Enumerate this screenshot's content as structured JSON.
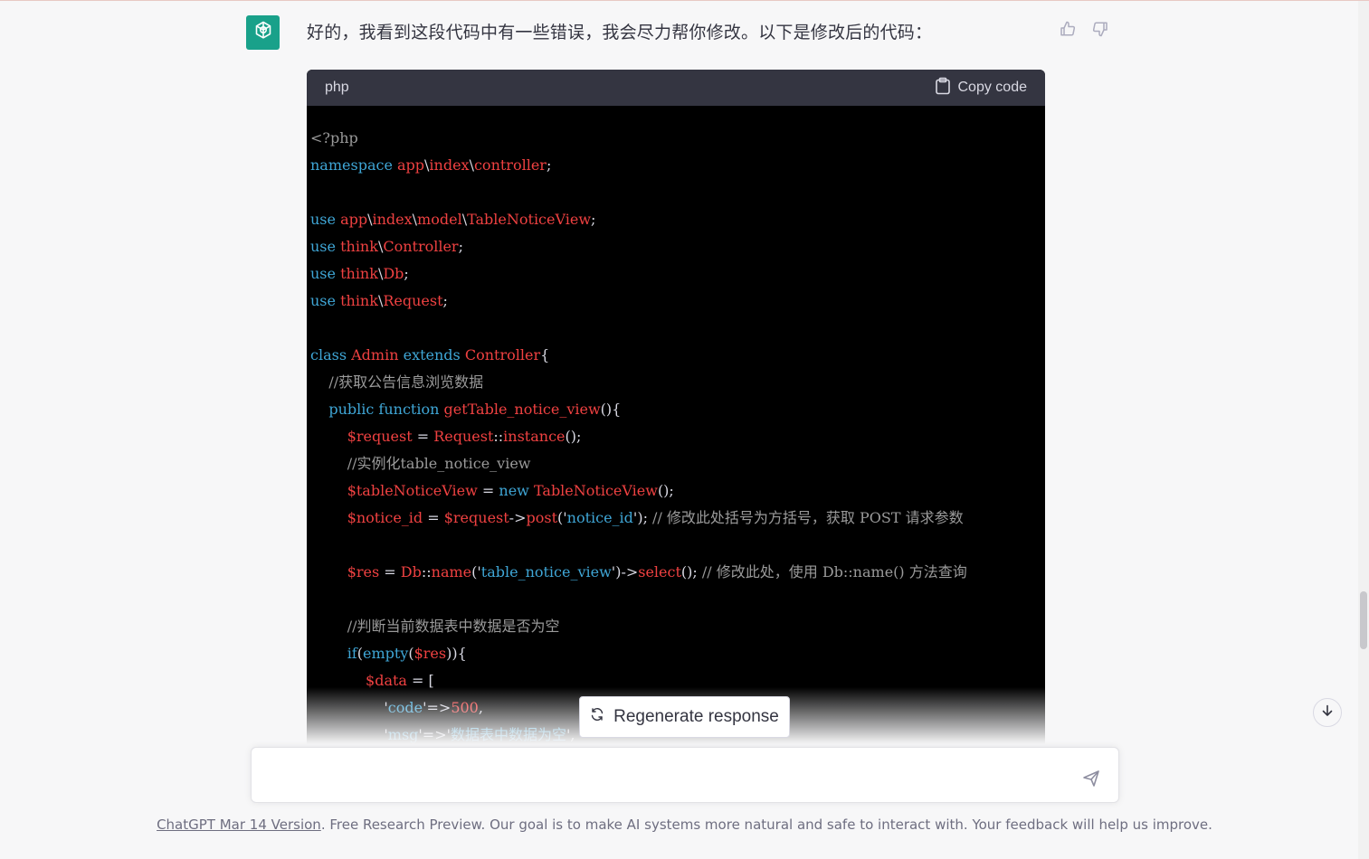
{
  "message": {
    "text": "好的，我看到这段代码中有一些错误，我会尽力帮你修改。以下是修改后的代码："
  },
  "code_block": {
    "language": "php",
    "copy_label": "Copy code",
    "lines": [
      [
        {
          "t": "<?php",
          "c": "cm"
        }
      ],
      [
        {
          "t": "namespace ",
          "c": "kw"
        },
        {
          "t": "app",
          "c": "nm"
        },
        {
          "t": "\\",
          "c": "pl"
        },
        {
          "t": "index",
          "c": "nm"
        },
        {
          "t": "\\",
          "c": "pl"
        },
        {
          "t": "controller",
          "c": "nm"
        },
        {
          "t": ";",
          "c": "pl"
        }
      ],
      [],
      [
        {
          "t": "use ",
          "c": "kw"
        },
        {
          "t": "app",
          "c": "nm"
        },
        {
          "t": "\\",
          "c": "pl"
        },
        {
          "t": "index",
          "c": "nm"
        },
        {
          "t": "\\",
          "c": "pl"
        },
        {
          "t": "model",
          "c": "nm"
        },
        {
          "t": "\\",
          "c": "pl"
        },
        {
          "t": "TableNoticeView",
          "c": "nm"
        },
        {
          "t": ";",
          "c": "pl"
        }
      ],
      [
        {
          "t": "use ",
          "c": "kw"
        },
        {
          "t": "think",
          "c": "nm"
        },
        {
          "t": "\\",
          "c": "pl"
        },
        {
          "t": "Controller",
          "c": "nm"
        },
        {
          "t": ";",
          "c": "pl"
        }
      ],
      [
        {
          "t": "use ",
          "c": "kw"
        },
        {
          "t": "think",
          "c": "nm"
        },
        {
          "t": "\\",
          "c": "pl"
        },
        {
          "t": "Db",
          "c": "nm"
        },
        {
          "t": ";",
          "c": "pl"
        }
      ],
      [
        {
          "t": "use ",
          "c": "kw"
        },
        {
          "t": "think",
          "c": "nm"
        },
        {
          "t": "\\",
          "c": "pl"
        },
        {
          "t": "Request",
          "c": "nm"
        },
        {
          "t": ";",
          "c": "pl"
        }
      ],
      [],
      [
        {
          "t": "class ",
          "c": "kw"
        },
        {
          "t": "Admin ",
          "c": "nm"
        },
        {
          "t": "extends ",
          "c": "kw"
        },
        {
          "t": "Controller",
          "c": "nm"
        },
        {
          "t": "{",
          "c": "pl"
        }
      ],
      [
        {
          "t": "    //获取公告信息浏览数据",
          "c": "cm"
        }
      ],
      [
        {
          "t": "    public ",
          "c": "kw"
        },
        {
          "t": "function ",
          "c": "kw"
        },
        {
          "t": "getTable_notice_view",
          "c": "fn"
        },
        {
          "t": "(){",
          "c": "pl"
        }
      ],
      [
        {
          "t": "        $request",
          "c": "var"
        },
        {
          "t": " = ",
          "c": "pl"
        },
        {
          "t": "Request",
          "c": "nm"
        },
        {
          "t": "::",
          "c": "pl"
        },
        {
          "t": "instance",
          "c": "fn"
        },
        {
          "t": "();",
          "c": "pl"
        }
      ],
      [
        {
          "t": "        //实例化table_notice_view",
          "c": "cm"
        }
      ],
      [
        {
          "t": "        $tableNoticeView",
          "c": "var"
        },
        {
          "t": " = ",
          "c": "pl"
        },
        {
          "t": "new ",
          "c": "kw"
        },
        {
          "t": "TableNoticeView",
          "c": "nm"
        },
        {
          "t": "();",
          "c": "pl"
        }
      ],
      [
        {
          "t": "        $notice_id",
          "c": "var"
        },
        {
          "t": " = ",
          "c": "pl"
        },
        {
          "t": "$request",
          "c": "var"
        },
        {
          "t": "->",
          "c": "pl"
        },
        {
          "t": "post",
          "c": "fn"
        },
        {
          "t": "('",
          "c": "pl"
        },
        {
          "t": "notice_id",
          "c": "str"
        },
        {
          "t": "'); ",
          "c": "pl"
        },
        {
          "t": "// 修改此处括号为方括号，获取 POST 请求参数",
          "c": "cm"
        }
      ],
      [],
      [
        {
          "t": "        $res",
          "c": "var"
        },
        {
          "t": " = ",
          "c": "pl"
        },
        {
          "t": "Db",
          "c": "nm"
        },
        {
          "t": "::",
          "c": "pl"
        },
        {
          "t": "name",
          "c": "fn"
        },
        {
          "t": "('",
          "c": "pl"
        },
        {
          "t": "table_notice_view",
          "c": "str"
        },
        {
          "t": "')->",
          "c": "pl"
        },
        {
          "t": "select",
          "c": "fn"
        },
        {
          "t": "(); ",
          "c": "pl"
        },
        {
          "t": "// 修改此处，使用 Db::name() 方法查询",
          "c": "cm"
        }
      ],
      [],
      [
        {
          "t": "        //判断当前数据表中数据是否为空",
          "c": "cm"
        }
      ],
      [
        {
          "t": "        if",
          "c": "kw"
        },
        {
          "t": "(",
          "c": "pl"
        },
        {
          "t": "empty",
          "c": "kw"
        },
        {
          "t": "(",
          "c": "pl"
        },
        {
          "t": "$res",
          "c": "var"
        },
        {
          "t": ")){",
          "c": "pl"
        }
      ],
      [
        {
          "t": "            $data",
          "c": "var"
        },
        {
          "t": " = [",
          "c": "pl"
        }
      ],
      [
        {
          "t": "                '",
          "c": "pl"
        },
        {
          "t": "code",
          "c": "str"
        },
        {
          "t": "'=>",
          "c": "pl"
        },
        {
          "t": "500",
          "c": "num"
        },
        {
          "t": ",",
          "c": "pl"
        }
      ],
      [
        {
          "t": "                '",
          "c": "pl"
        },
        {
          "t": "msg",
          "c": "str"
        },
        {
          "t": "'=>'",
          "c": "pl"
        },
        {
          "t": "数据表中数据为空",
          "c": "str"
        },
        {
          "t": "',",
          "c": "pl"
        }
      ]
    ]
  },
  "regenerate_label": "Regenerate response",
  "input": {
    "placeholder": ""
  },
  "footer": {
    "link_text": "ChatGPT Mar 14 Version",
    "text": ". Free Research Preview. Our goal is to make AI systems more natural and safe to interact with. Your feedback will help us improve."
  },
  "colors": {
    "avatar_bg": "#19a18a",
    "code_bg": "#000000",
    "code_header_bg": "#343541",
    "keyword": "#3fa6d6",
    "name": "#ef4141",
    "comment": "#9a9a9a"
  },
  "icons": {
    "avatar": "openai-logo-icon",
    "thumbs_up": "thumbs-up-icon",
    "thumbs_down": "thumbs-down-icon",
    "copy": "clipboard-icon",
    "regenerate": "refresh-icon",
    "scroll_down": "arrow-down-icon",
    "send": "send-icon"
  }
}
